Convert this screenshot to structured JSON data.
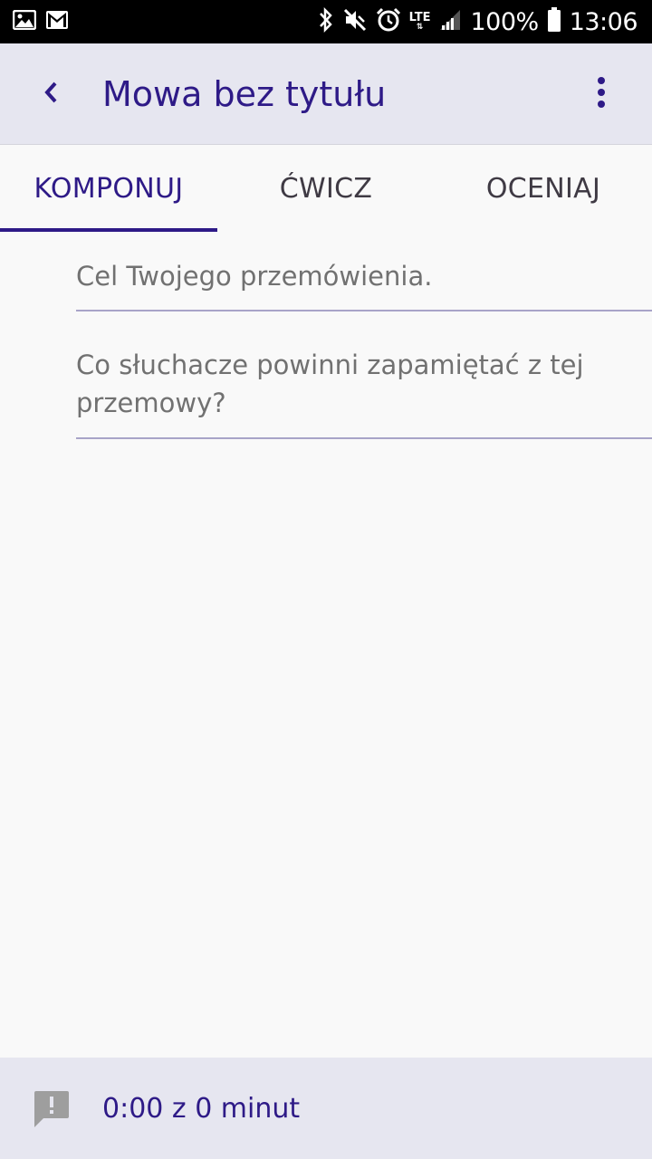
{
  "status_bar": {
    "battery_text": "100%",
    "time": "13:06",
    "network": "LTE",
    "icons": [
      "image-icon",
      "gmail-icon",
      "bluetooth-icon",
      "mute-icon",
      "alarm-icon",
      "lte-icon",
      "signal-icon",
      "battery-icon"
    ]
  },
  "app_bar": {
    "title": "Mowa bez tytułu",
    "accent_color": "#2e1a87",
    "background_color": "#e6e6f0"
  },
  "tabs": [
    {
      "label": "KOMPONUJ",
      "active": true
    },
    {
      "label": "ĆWICZ",
      "active": false
    },
    {
      "label": "OCENIAJ",
      "active": false
    }
  ],
  "fields": [
    {
      "placeholder": "Cel Twojego przemówienia."
    },
    {
      "placeholder": "Co słuchacze powinni zapamiętać z tej przemowy?"
    }
  ],
  "bottom_bar": {
    "timer_text": "0:00 z 0 minut"
  }
}
